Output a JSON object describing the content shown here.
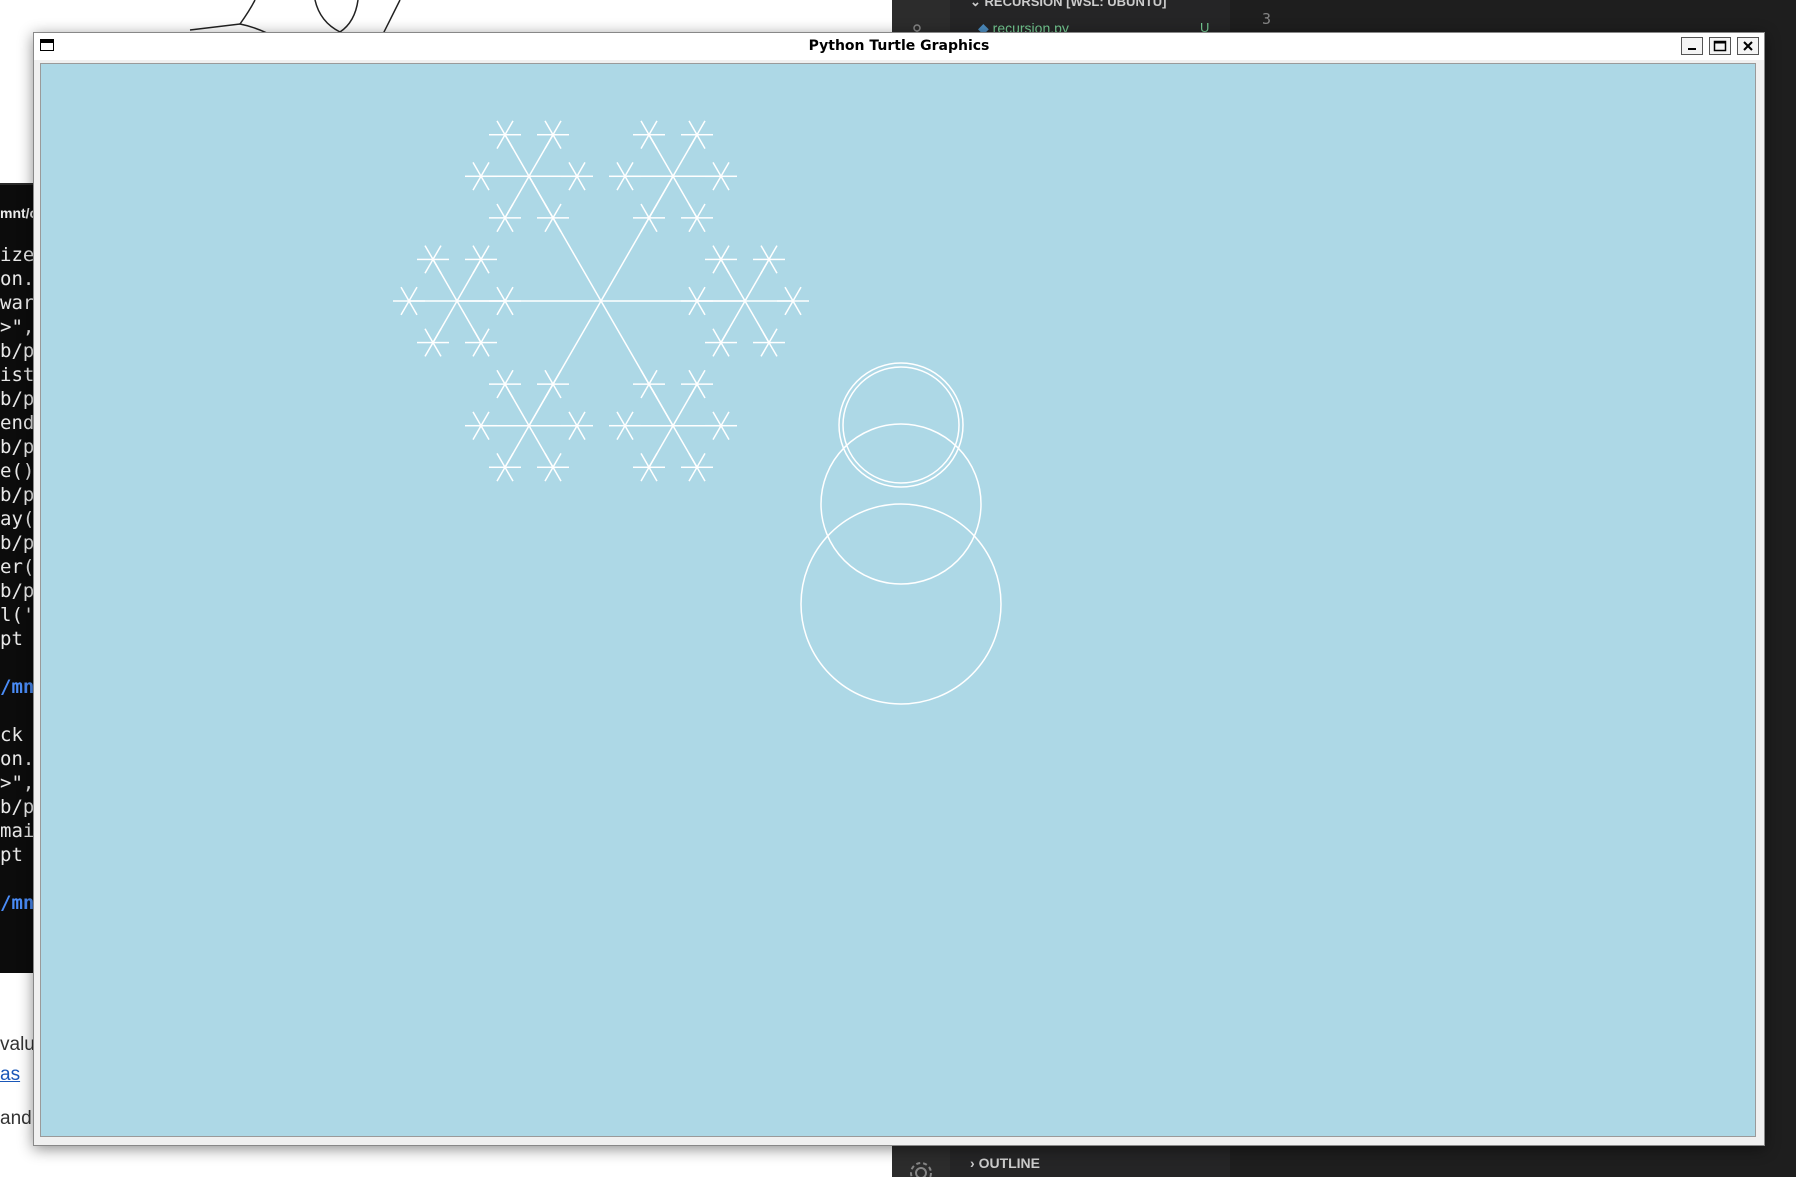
{
  "window": {
    "title": "Python Turtle Graphics",
    "canvas_color": "#add8e6",
    "pen_color": "#ffffff"
  },
  "background": {
    "vscode": {
      "explorer_section": "RECURSION [WSL: UBUNTU]",
      "file_name": "recursion.py",
      "file_badge": "U",
      "outline_label": "OUTLINE",
      "line_number": "3"
    },
    "terminal": {
      "title": "mnt/c",
      "lines": [
        "ize",
        "on.",
        "war",
        ">\",",
        "b/p",
        "ist",
        "b/p",
        "end",
        "b/p",
        "e()",
        "b/p",
        "ay(",
        "b/p",
        "er(",
        "b/p",
        "l('",
        "pt",
        "",
        "/mn",
        "",
        "ck",
        "on.",
        ">\",",
        "b/p",
        "mai",
        "pt",
        "",
        "/mn"
      ]
    },
    "page_text": [
      "valu",
      "as",
      "and"
    ]
  }
}
